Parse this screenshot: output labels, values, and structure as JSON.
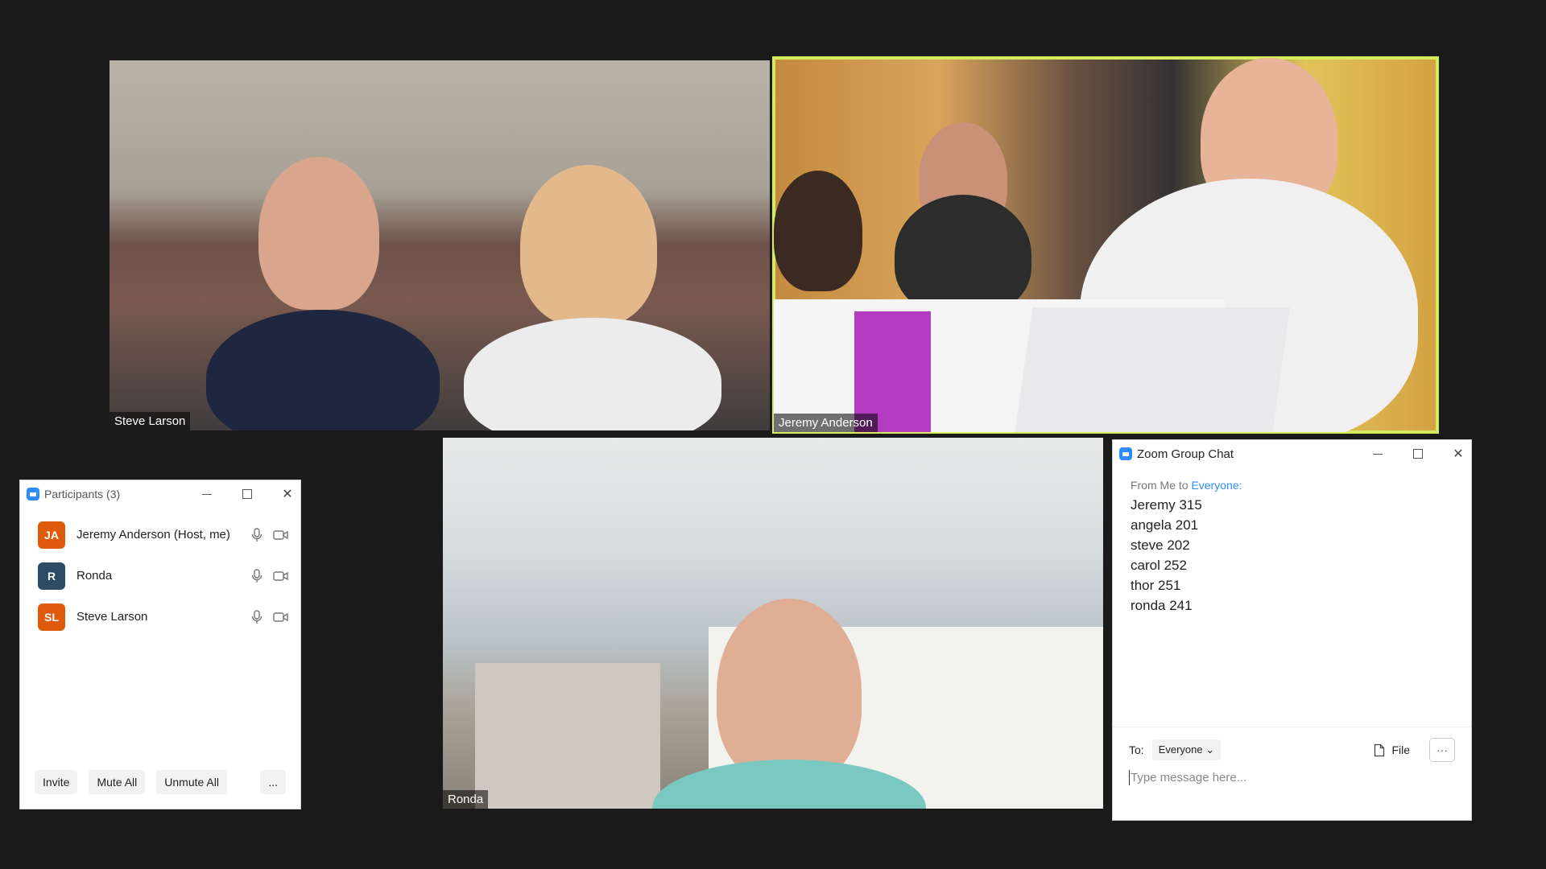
{
  "tiles": [
    {
      "name": "Steve Larson"
    },
    {
      "name": "Jeremy Anderson"
    },
    {
      "name": "Ronda"
    }
  ],
  "participants": {
    "title": "Participants (3)",
    "list": [
      {
        "initials": "JA",
        "name": "Jeremy Anderson (Host, me)",
        "color": "#e05a0c"
      },
      {
        "initials": "R",
        "name": "Ronda",
        "color": "#2f4a63"
      },
      {
        "initials": "SL",
        "name": "Steve Larson",
        "color": "#e05a0c"
      }
    ],
    "buttons": {
      "invite": "Invite",
      "mute_all": "Mute All",
      "unmute_all": "Unmute All",
      "more": "..."
    }
  },
  "chat": {
    "title": "Zoom Group Chat",
    "from_prefix": "From Me to ",
    "from_target": "Everyone:",
    "messages": [
      "Jeremy 315",
      "angela 201",
      "steve 202",
      "carol 252",
      "thor 251",
      "ronda 241"
    ],
    "to_label": "To:",
    "to_value": "Everyone",
    "file_label": "File",
    "more_label": "···",
    "placeholder": "Type message here..."
  },
  "colors": {
    "active_speaker": "#d6ec5c",
    "zoom_blue": "#2d8cff"
  }
}
